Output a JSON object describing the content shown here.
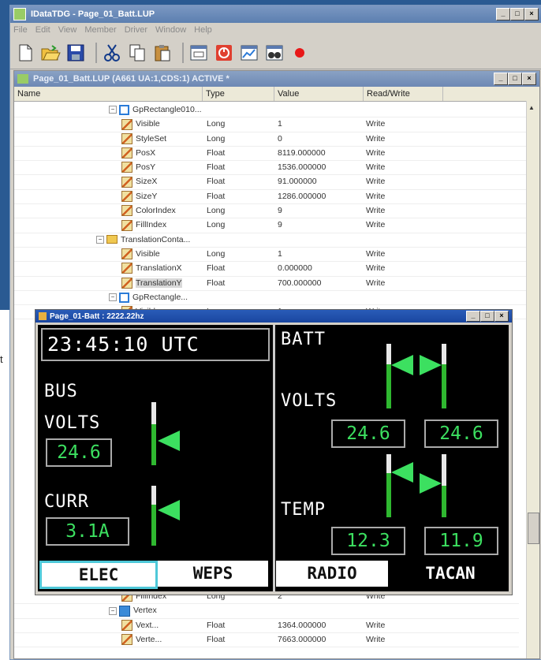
{
  "app": {
    "title": "IDataTDG - Page_01_Batt.LUP",
    "menu": [
      "File",
      "Edit",
      "View",
      "Member",
      "Driver",
      "Window",
      "Help"
    ]
  },
  "toolbar": [
    "new-icon",
    "open-icon",
    "save-icon",
    "cut-icon",
    "copy-icon",
    "paste-icon",
    "window-icon",
    "stop-icon",
    "chart-icon",
    "binoculars-icon",
    "record-icon"
  ],
  "child": {
    "title": "Page_01_Batt.LUP (A661 UA:1,CDS:1) ACTIVE *",
    "columns": [
      "Name",
      "Type",
      "Value",
      "Read/Write"
    ],
    "rows": [
      {
        "name": "GpRectangle010...",
        "type": "",
        "value": "",
        "rw": "",
        "kind": "rect",
        "indent": 1,
        "exp": "⊟"
      },
      {
        "name": "Visible",
        "type": "Long",
        "value": "1",
        "rw": "Write",
        "kind": "prop",
        "indent": 2
      },
      {
        "name": "StyleSet",
        "type": "Long",
        "value": "0",
        "rw": "Write",
        "kind": "prop",
        "indent": 2
      },
      {
        "name": "PosX",
        "type": "Float",
        "value": "8119.000000",
        "rw": "Write",
        "kind": "prop",
        "indent": 2
      },
      {
        "name": "PosY",
        "type": "Float",
        "value": "1536.000000",
        "rw": "Write",
        "kind": "prop",
        "indent": 2
      },
      {
        "name": "SizeX",
        "type": "Float",
        "value": "91.000000",
        "rw": "Write",
        "kind": "prop",
        "indent": 2
      },
      {
        "name": "SizeY",
        "type": "Float",
        "value": "1286.000000",
        "rw": "Write",
        "kind": "prop",
        "indent": 2
      },
      {
        "name": "ColorIndex",
        "type": "Long",
        "value": "9",
        "rw": "Write",
        "kind": "prop",
        "indent": 2
      },
      {
        "name": "FillIndex",
        "type": "Long",
        "value": "9",
        "rw": "Write",
        "kind": "prop",
        "indent": 2
      },
      {
        "name": "TranslationConta...",
        "type": "",
        "value": "",
        "rw": "",
        "kind": "folder",
        "indent": 0,
        "exp": "⊟"
      },
      {
        "name": "Visible",
        "type": "Long",
        "value": "1",
        "rw": "Write",
        "kind": "prop",
        "indent": 2
      },
      {
        "name": "TranslationX",
        "type": "Float",
        "value": "0.000000",
        "rw": "Write",
        "kind": "prop",
        "indent": 2
      },
      {
        "name": "TranslationY",
        "type": "Float",
        "value": "700.000000",
        "rw": "Write",
        "kind": "prop",
        "indent": 2,
        "sel": true
      },
      {
        "name": "GpRectangle...",
        "type": "",
        "value": "",
        "rw": "",
        "kind": "rect",
        "indent": 1,
        "exp": "⊟"
      },
      {
        "name": "Visible",
        "type": "Long",
        "value": "1",
        "rw": "Write",
        "kind": "prop",
        "indent": 2
      }
    ],
    "rows_bottom": [
      {
        "name": "FillIndex",
        "type": "Long",
        "value": "2",
        "rw": "Write",
        "kind": "prop",
        "indent": 2
      },
      {
        "name": "Vertex",
        "type": "",
        "value": "",
        "rw": "",
        "kind": "vert",
        "indent": 1,
        "exp": "⊟"
      },
      {
        "name": "Vext...",
        "type": "Float",
        "value": "1364.000000",
        "rw": "Write",
        "kind": "prop",
        "indent": 2
      },
      {
        "name": "Verte...",
        "type": "Float",
        "value": "7663.000000",
        "rw": "Write",
        "kind": "prop",
        "indent": 2
      }
    ]
  },
  "display": {
    "title": "Page_01-Batt : 2222.22hz",
    "time": "23:45:10 UTC",
    "bus_label": "BUS",
    "volts_label": "VOLTS",
    "bus_volts": "24.6",
    "curr_label": "CURR",
    "curr_value": "3.1A",
    "batt_label": "BATT",
    "batt_volts_label": "VOLTS",
    "batt_volts_1": "24.6",
    "batt_volts_2": "24.6",
    "temp_label": "TEMP",
    "temp_1": "12.3",
    "temp_2": "11.9",
    "tabs": [
      "ELEC",
      "WEPS",
      "RADIO",
      "TACAN"
    ],
    "colors": {
      "green": "#3ce060",
      "bar": "#2fb830",
      "selected_tab": "#4ec8d8"
    }
  },
  "left_cut_text": "t"
}
